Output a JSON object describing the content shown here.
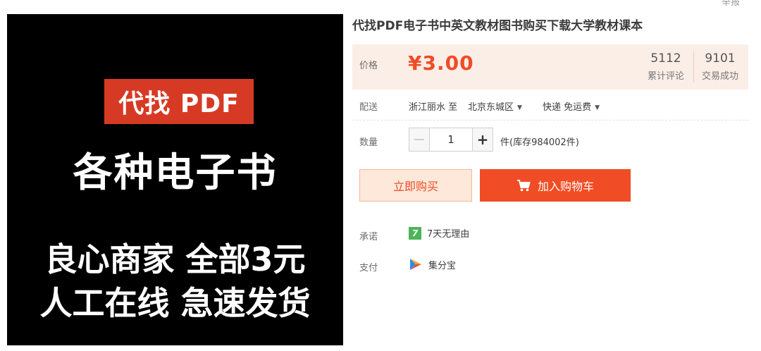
{
  "report_link": "举报",
  "product_image": {
    "tag": "代找 PDF",
    "line1": "各种电子书",
    "line2": "良心商家 全部3元",
    "line3": "人工在线 急速发货"
  },
  "title": "代找PDF电子书中英文教材图书购买下载大学教材课本",
  "price": {
    "label": "价格",
    "value": "¥3.00",
    "reviews_count": "5112",
    "reviews_label": "累计评论",
    "trades_count": "9101",
    "trades_label": "交易成功"
  },
  "shipping": {
    "label": "配送",
    "from": "浙江丽水 至",
    "to": "北京东城区",
    "method": "快递 免运费"
  },
  "quantity": {
    "label": "数量",
    "minus": "−",
    "value": "1",
    "plus": "+",
    "stock": "件(库存984002件)"
  },
  "buttons": {
    "buy_now": "立即购买",
    "add_to_cart": "加入购物车"
  },
  "promise": {
    "label": "承诺",
    "badge": "7",
    "text": "7天无理由"
  },
  "payment": {
    "label": "支付",
    "text": "集分宝"
  },
  "colors": {
    "accent": "#f04c25",
    "price_bg": "#fbeee7",
    "buy_now_bg": "#fde8da",
    "badge_green": "#4db559",
    "image_tag_red": "#d73a24"
  },
  "icons": {
    "cart": "cart-icon",
    "caret": "caret-down-icon",
    "promise": "seven-days-badge-icon",
    "payment": "jifenbao-icon"
  }
}
